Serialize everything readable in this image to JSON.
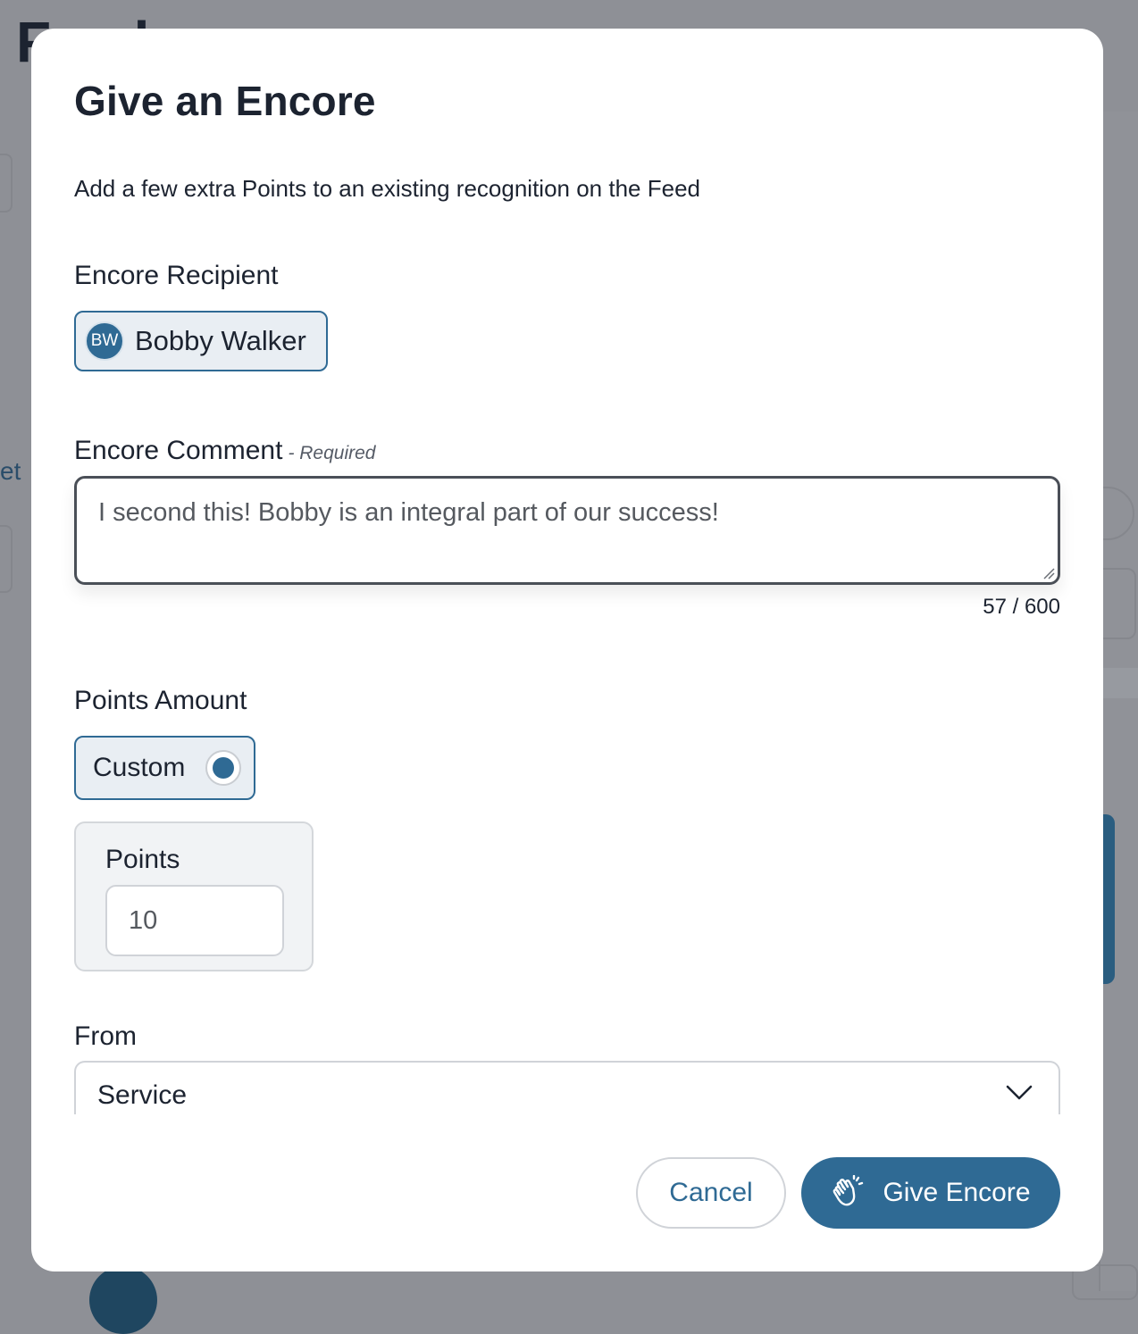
{
  "background": {
    "page_title_fragment": "Feed",
    "side_text_fragment": "et"
  },
  "modal": {
    "title": "Give an Encore",
    "subtitle": "Add a few extra Points to an existing recognition on the Feed",
    "recipient": {
      "label": "Encore Recipient",
      "initials": "BW",
      "name": "Bobby Walker"
    },
    "comment": {
      "label": "Encore Comment",
      "required_tag": "- Required",
      "value": "I second this! Bobby is an integral part of our success!",
      "char_count": "57 / 600"
    },
    "points": {
      "label": "Points Amount",
      "option_label": "Custom",
      "option_selected": true,
      "points_label": "Points",
      "points_value": "10"
    },
    "from": {
      "label": "From",
      "selected": "Service"
    },
    "actions": {
      "cancel_label": "Cancel",
      "submit_label": "Give Encore"
    }
  },
  "colors": {
    "accent": "#2f6a94",
    "text": "#1c2330",
    "overlay": "#8e9096"
  },
  "icons": [
    "clapping-hands-icon",
    "chevron-down-icon",
    "resize-handle-icon"
  ]
}
